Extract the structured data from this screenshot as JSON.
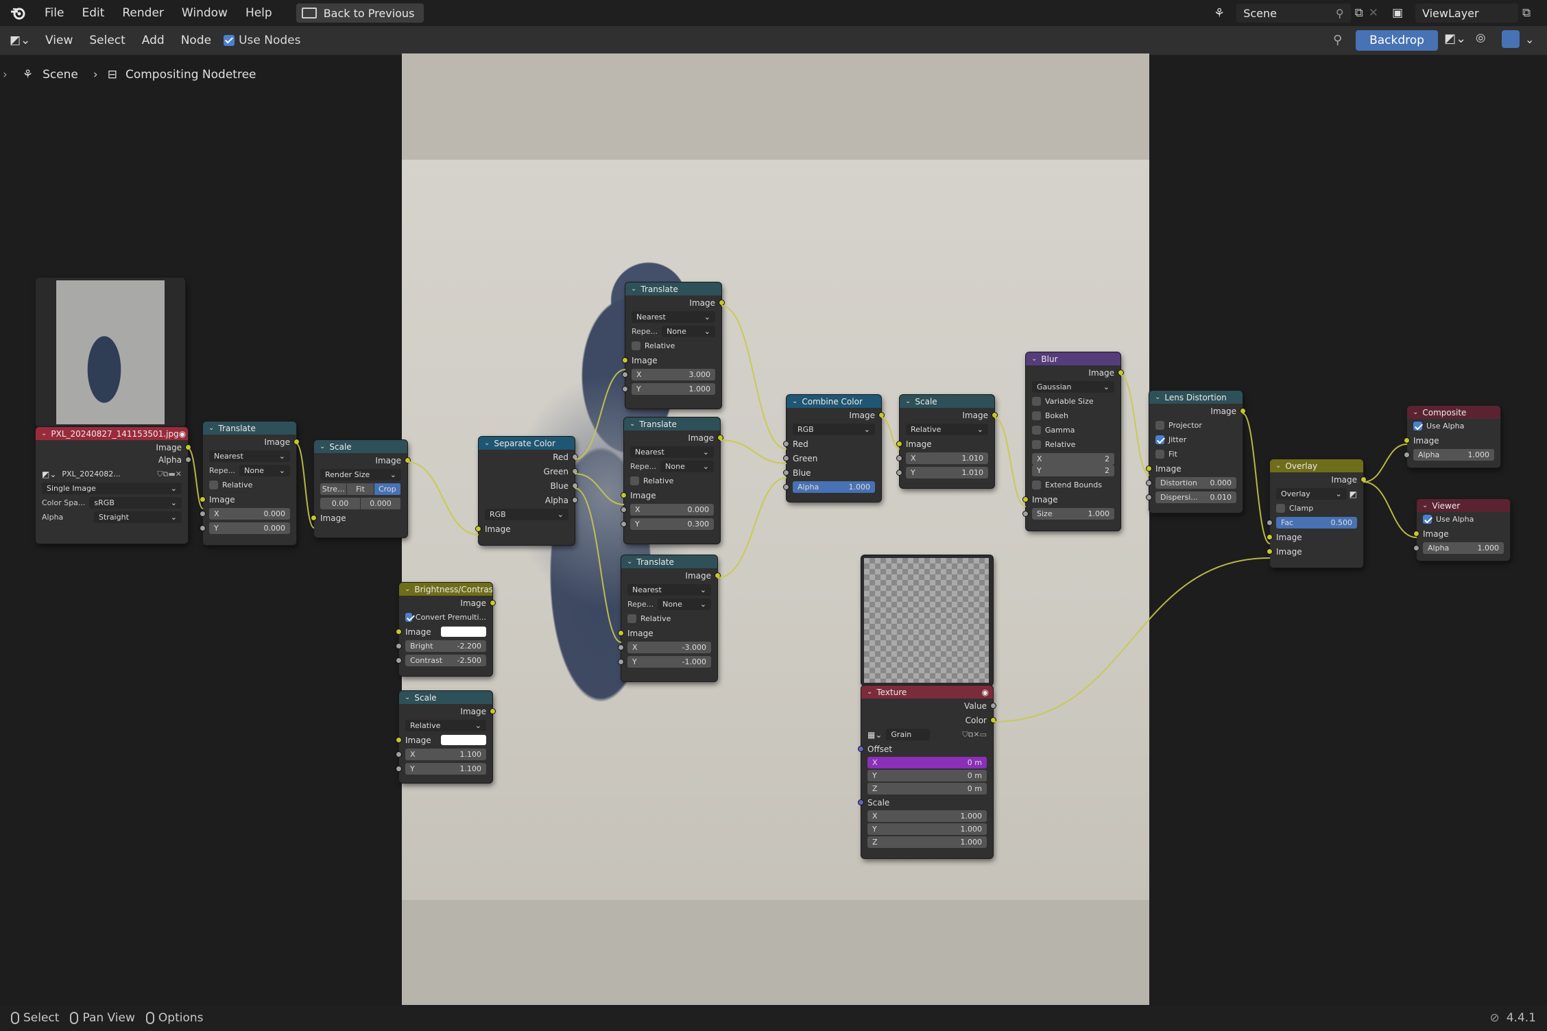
{
  "menu": {
    "items": [
      "File",
      "Edit",
      "Render",
      "Window",
      "Help"
    ],
    "back": "Back to Previous"
  },
  "scene": "Scene",
  "viewlayer": "ViewLayer",
  "header": {
    "items": [
      "View",
      "Select",
      "Add",
      "Node"
    ],
    "use_nodes": "Use Nodes",
    "backdrop": "Backdrop"
  },
  "breadcrumb": {
    "scene": "Scene",
    "tree": "Compositing Nodetree"
  },
  "status": {
    "select": "Select",
    "pan": "Pan View",
    "options": "Options",
    "version": "4.4.1"
  },
  "nodes": {
    "image": {
      "title": "PXL_20240827_141153501.jpg",
      "out1": "Image",
      "out2": "Alpha",
      "file": "PXL_2024082...",
      "source": "Single Image",
      "cs_label": "Color Spa...",
      "cs": "sRGB",
      "alpha_label": "Alpha",
      "alpha": "Straight"
    },
    "translate0": {
      "title": "Translate",
      "out": "Image",
      "filter": "Nearest",
      "rep_label": "Repe...",
      "rep": "None",
      "relative": "Relative",
      "in": "Image",
      "x": "0.000",
      "y": "0.000"
    },
    "scale0": {
      "title": "Scale",
      "out": "Image",
      "mode": "Render Size",
      "seg": [
        "Stre...",
        "Fit",
        "Crop"
      ],
      "v1": "0.00",
      "v2": "0.000",
      "in": "Image"
    },
    "sep": {
      "title": "Separate Color",
      "o1": "Red",
      "o2": "Green",
      "o3": "Blue",
      "o4": "Alpha",
      "mode": "RGB",
      "in": "Image"
    },
    "t1": {
      "title": "Translate",
      "out": "Image",
      "filter": "Nearest",
      "rep_label": "Repe...",
      "rep": "None",
      "relative": "Relative",
      "in": "Image",
      "x": "3.000",
      "y": "1.000"
    },
    "t2": {
      "title": "Translate",
      "out": "Image",
      "filter": "Nearest",
      "rep_label": "Repe...",
      "rep": "None",
      "relative": "Relative",
      "in": "Image",
      "x": "0.000",
      "y": "0.300"
    },
    "t3": {
      "title": "Translate",
      "out": "Image",
      "filter": "Nearest",
      "rep_label": "Repe...",
      "rep": "None",
      "relative": "Relative",
      "in": "Image",
      "x": "-3.000",
      "y": "-1.000"
    },
    "bc": {
      "title": "Brightness/Contrast",
      "out": "Image",
      "convert": "Convert Premulti...",
      "in": "Image",
      "bright_l": "Bright",
      "bright": "-2.200",
      "contrast_l": "Contrast",
      "contrast": "-2.500"
    },
    "scale2": {
      "title": "Scale",
      "out": "Image",
      "mode": "Relative",
      "in": "Image",
      "x": "1.100",
      "y": "1.100"
    },
    "combine": {
      "title": "Combine Color",
      "out": "Image",
      "mode": "RGB",
      "i1": "Red",
      "i2": "Green",
      "i3": "Blue",
      "alpha_l": "Alpha",
      "alpha": "1.000"
    },
    "scale3": {
      "title": "Scale",
      "out": "Image",
      "mode": "Relative",
      "in": "Image",
      "x": "1.010",
      "y": "1.010"
    },
    "blur": {
      "title": "Blur",
      "out": "Image",
      "type": "Gaussian",
      "c1": "Variable Size",
      "c2": "Bokeh",
      "c3": "Gamma",
      "c4": "Relative",
      "x": "2",
      "y": "2",
      "c5": "Extend Bounds",
      "in": "Image",
      "size_l": "Size",
      "size": "1.000"
    },
    "lens": {
      "title": "Lens Distortion",
      "out": "Image",
      "c1": "Projector",
      "c2": "Jitter",
      "c3": "Fit",
      "in": "Image",
      "dist_l": "Distortion",
      "dist": "0.000",
      "disp_l": "Dispersi...",
      "disp": "0.010"
    },
    "texture": {
      "title": "Texture",
      "o1": "Value",
      "o2": "Color",
      "tex": "Grain",
      "offset": "Offset",
      "ox": "0 m",
      "oy": "0 m",
      "oz": "0 m",
      "scale": "Scale",
      "sx": "1.000",
      "sy": "1.000",
      "sz": "1.000"
    },
    "overlay": {
      "title": "Overlay",
      "out": "Image",
      "mode": "Overlay",
      "clamp": "Clamp",
      "fac_l": "Fac",
      "fac": "0.500",
      "i1": "Image",
      "i2": "Image"
    },
    "composite": {
      "title": "Composite",
      "use_alpha": "Use Alpha",
      "in": "Image",
      "alpha_l": "Alpha",
      "alpha": "1.000"
    },
    "viewer": {
      "title": "Viewer",
      "use_alpha": "Use Alpha",
      "in": "Image",
      "alpha_l": "Alpha",
      "alpha": "1.000"
    }
  },
  "colors": {
    "input_header": "#9a2b3b",
    "converter_header": "#1f5673",
    "distort_header": "#2e5058",
    "filter_header": "#553c7a",
    "color_header": "#6e6e1a",
    "texture_header": "#7c2b3a",
    "output_header": "#5b2332",
    "accent": "#4772b3"
  }
}
